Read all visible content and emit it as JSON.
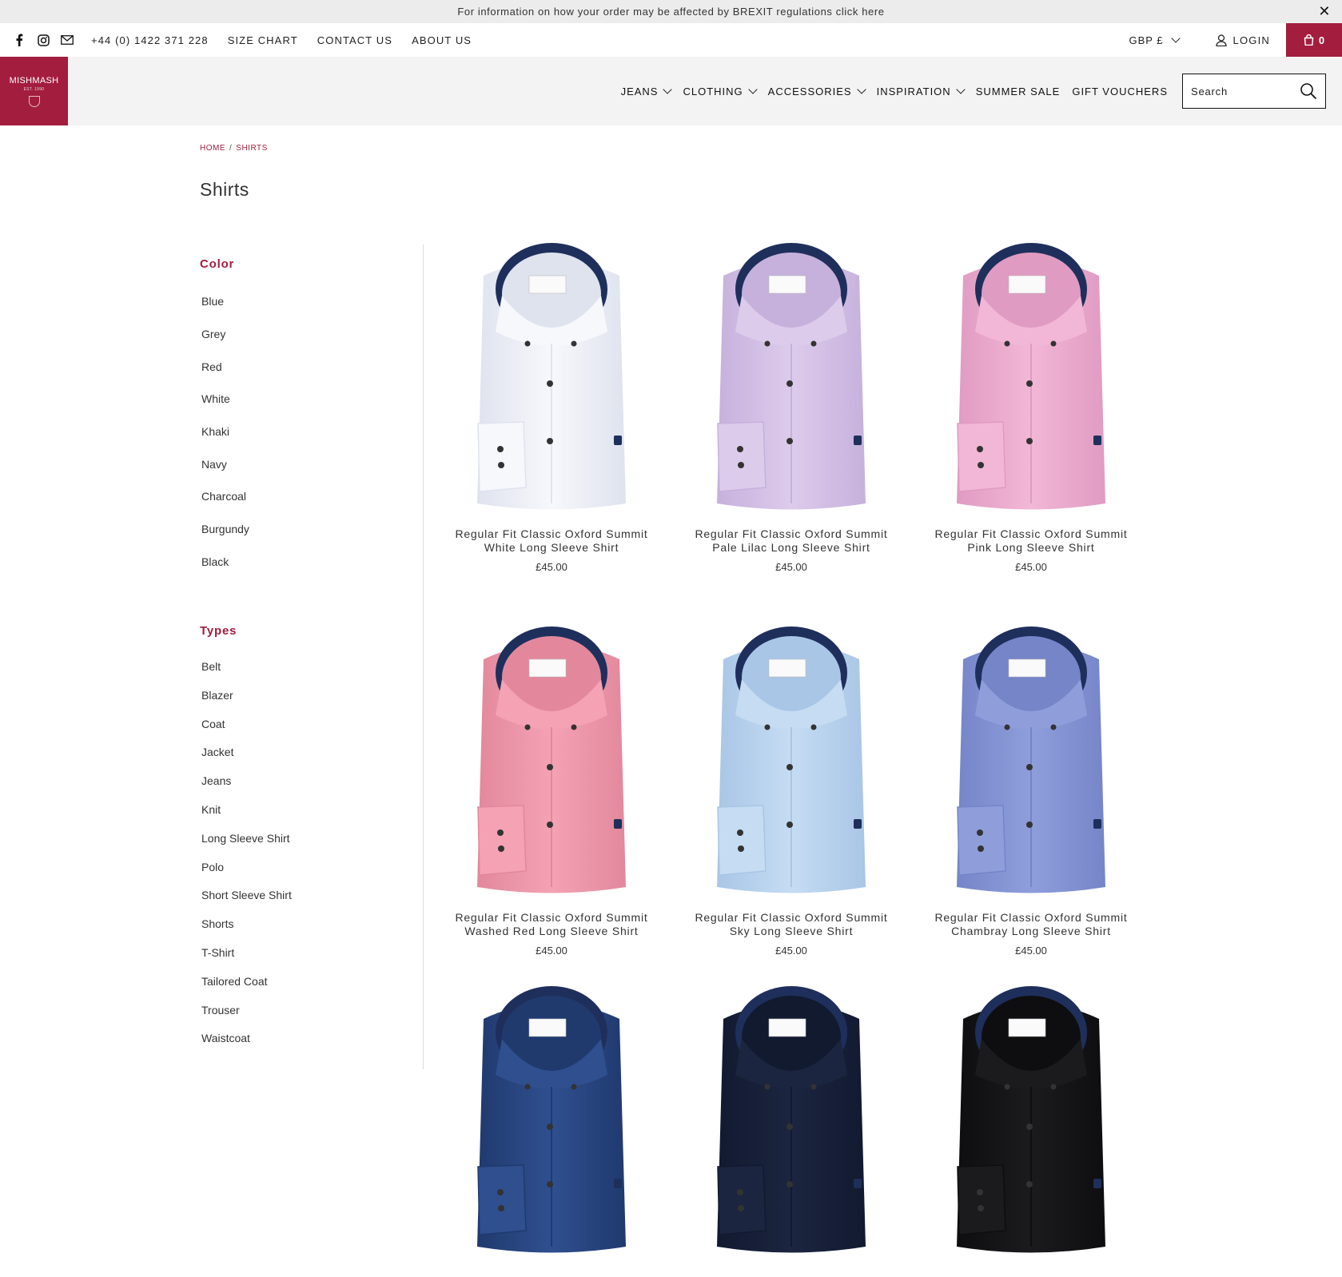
{
  "announcement": {
    "text": "For information on how your order may be affected by BREXIT regulations click here",
    "close": "✕"
  },
  "topbar": {
    "phone": "+44 (0) 1422 371 228",
    "links": [
      "SIZE CHART",
      "CONTACT US",
      "ABOUT US"
    ],
    "currency": "GBP £",
    "login": "LOGIN",
    "cart_count": "0"
  },
  "logo": {
    "text": "MISHMASH",
    "est": "EST. 1990"
  },
  "nav": [
    {
      "label": "JEANS",
      "dropdown": true
    },
    {
      "label": "CLOTHING",
      "dropdown": true
    },
    {
      "label": "ACCESSORIES",
      "dropdown": true
    },
    {
      "label": "INSPIRATION",
      "dropdown": true
    },
    {
      "label": "SUMMER SALE",
      "dropdown": false
    },
    {
      "label": "GIFT VOUCHERS",
      "dropdown": false
    }
  ],
  "search": {
    "placeholder": "Search"
  },
  "breadcrumb": {
    "home": "HOME",
    "separator": "/",
    "current": "SHIRTS"
  },
  "page_title": "Shirts",
  "filters": {
    "color": {
      "heading": "Color",
      "items": [
        "Blue",
        "Grey",
        "Red",
        "White",
        "Khaki",
        "Navy",
        "Charcoal",
        "Burgundy",
        "Black"
      ]
    },
    "types": {
      "heading": "Types",
      "items": [
        "Belt",
        "Blazer",
        "Coat",
        "Jacket",
        "Jeans",
        "Knit",
        "Long Sleeve Shirt",
        "Polo",
        "Short Sleeve Shirt",
        "Shorts",
        "T-Shirt",
        "Tailored Coat",
        "Trouser",
        "Waistcoat"
      ]
    }
  },
  "products": [
    {
      "title_line1": "Regular Fit Classic Oxford Summit",
      "title_line2": "White Long Sleeve Shirt",
      "price": "£45.00",
      "shirt_color": "#f7f8fc",
      "shade": "#dfe3ee"
    },
    {
      "title_line1": "Regular Fit Classic Oxford Summit",
      "title_line2": "Pale Lilac Long Sleeve Shirt",
      "price": "£45.00",
      "shirt_color": "#ddcbec",
      "shade": "#c6b1dc"
    },
    {
      "title_line1": "Regular Fit Classic Oxford Summit",
      "title_line2": "Pink Long Sleeve Shirt",
      "price": "£45.00",
      "shirt_color": "#f2b7d6",
      "shade": "#e09bc2"
    },
    {
      "title_line1": "Regular Fit Classic Oxford Summit",
      "title_line2": "Washed Red Long Sleeve Shirt",
      "price": "£45.00",
      "shirt_color": "#f4a2b4",
      "shade": "#e3889c"
    },
    {
      "title_line1": "Regular Fit Classic Oxford Summit",
      "title_line2": "Sky Long Sleeve Shirt",
      "price": "£45.00",
      "shirt_color": "#c5dcf3",
      "shade": "#a9c6e6"
    },
    {
      "title_line1": "Regular Fit Classic Oxford Summit",
      "title_line2": "Chambray Long Sleeve Shirt",
      "price": "£45.00",
      "shirt_color": "#8f9edb",
      "shade": "#7585c8"
    },
    {
      "title_line1": "",
      "title_line2": "",
      "price": "",
      "shirt_color": "#2f4f8f",
      "shade": "#203a6e"
    },
    {
      "title_line1": "",
      "title_line2": "",
      "price": "",
      "shirt_color": "#1c2540",
      "shade": "#121a30"
    },
    {
      "title_line1": "",
      "title_line2": "",
      "price": "",
      "shirt_color": "#1b1b1e",
      "shade": "#0e0e10"
    }
  ],
  "colors": {
    "brand": "#a31d3f",
    "collar_inner": "#1f2f5c"
  }
}
